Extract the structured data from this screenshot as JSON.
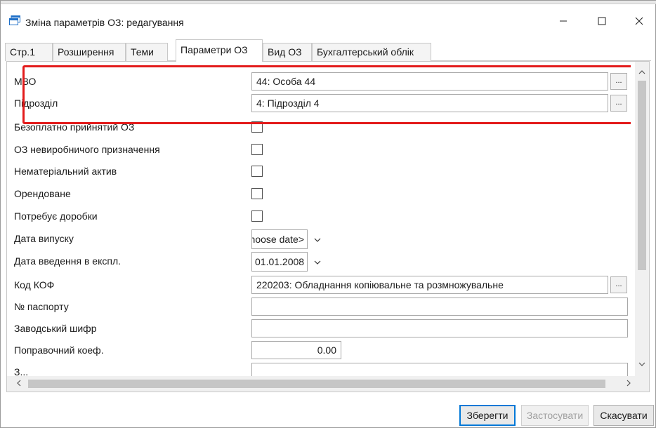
{
  "window": {
    "title": "Зміна параметрів ОЗ: редагування",
    "controls": {
      "minimize": "—",
      "maximize": "☐",
      "close": "✕"
    }
  },
  "tabs": [
    {
      "label": "Стр.1",
      "active": false
    },
    {
      "label": "Розширення",
      "active": false
    },
    {
      "label": "Теми",
      "active": false
    },
    {
      "label": "Параметри ОЗ",
      "active": true
    },
    {
      "label": "Вид ОЗ",
      "active": false
    },
    {
      "label": "Бухгалтерський облік",
      "active": false
    }
  ],
  "form": {
    "mvo": {
      "label": "МВО",
      "value": "44: Особа 44",
      "button": "..."
    },
    "subdivision": {
      "label": "Підрозділ",
      "value": "4: Підрозділ 4",
      "button": "..."
    },
    "free_accepted": {
      "label": "Безоплатно прийнятий ОЗ",
      "checked": false
    },
    "non_production": {
      "label": "ОЗ невиробничого призначення",
      "checked": false
    },
    "intangible": {
      "label": "Нематеріальний актив",
      "checked": false
    },
    "leased": {
      "label": "Орендоване",
      "checked": false
    },
    "needs_rework": {
      "label": "Потребує доробки",
      "checked": false
    },
    "release_date": {
      "label": "Дата випуску",
      "value": "<Choose date>"
    },
    "commission_date": {
      "label": "Дата введення в експл.",
      "value": "01.01.2008"
    },
    "kof_code": {
      "label": "Код КОФ",
      "value": "220203: Обладнання копіювальне та розмножувальне",
      "button": "..."
    },
    "passport_no": {
      "label": "№ паспорту",
      "value": ""
    },
    "factory_code": {
      "label": "Заводський шифр",
      "value": ""
    },
    "correction_coef": {
      "label": "Поправочний коеф.",
      "value": "0.00"
    },
    "partial_label": "З..."
  },
  "footer": {
    "save": "Зберегти",
    "apply": "Застосувати",
    "cancel": "Скасувати"
  },
  "colors": {
    "highlight": "#e31b1b",
    "focus_border": "#0078d7"
  }
}
